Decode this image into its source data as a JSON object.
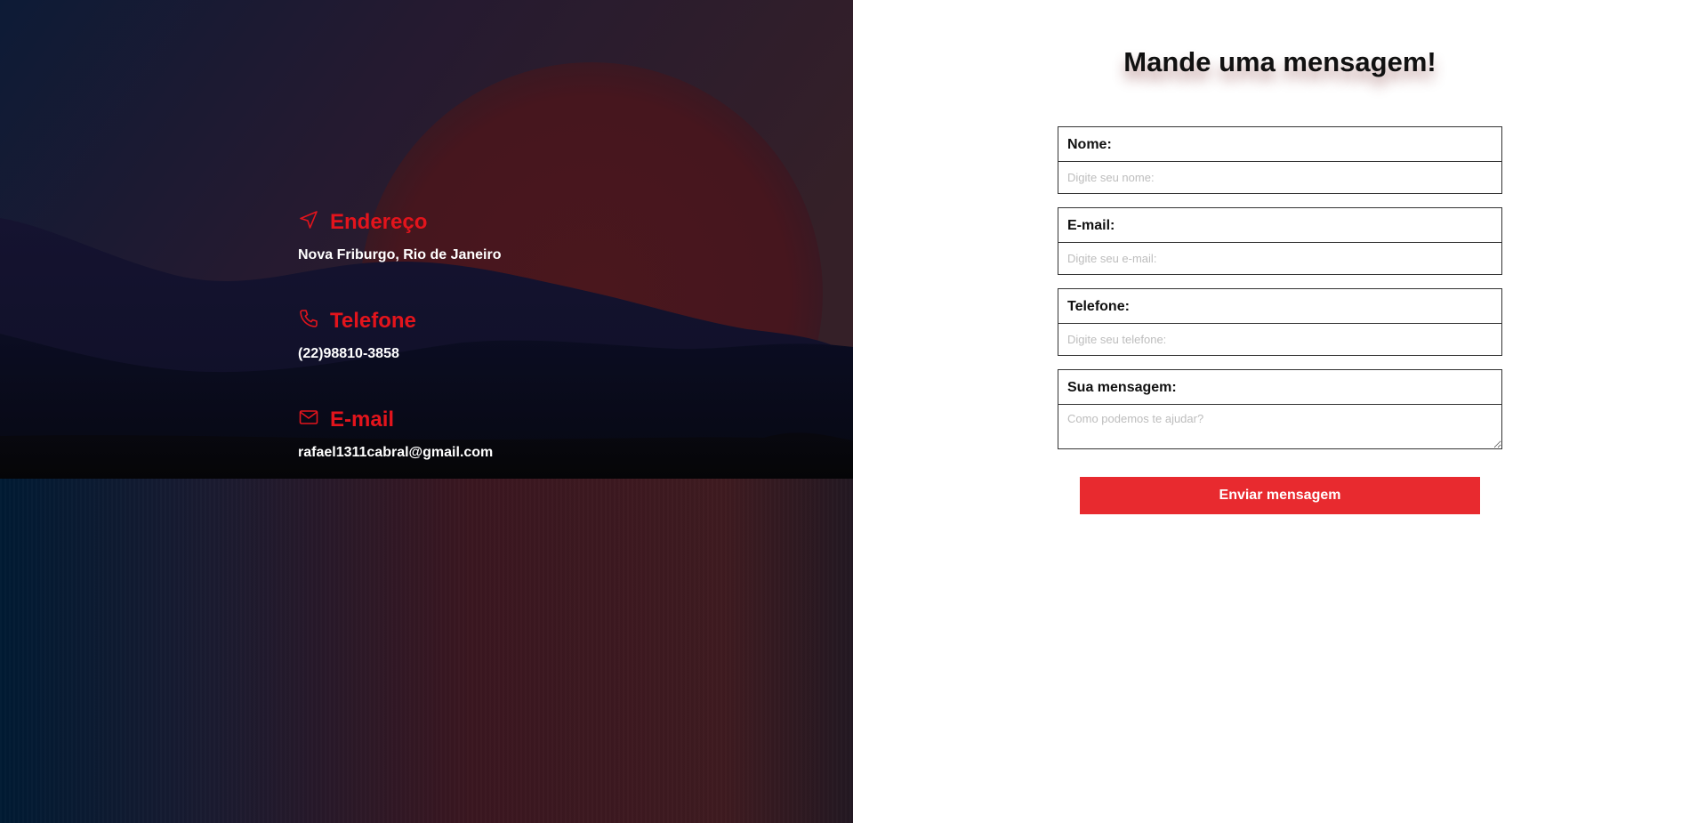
{
  "contact": {
    "address": {
      "title": "Endereço",
      "value": "Nova Friburgo, Rio de Janeiro",
      "icon": "navigation-arrow-icon"
    },
    "phone": {
      "title": "Telefone",
      "value": "(22)98810-3858",
      "icon": "phone-icon"
    },
    "email": {
      "title": "E-mail",
      "value": "rafael1311cabral@gmail.com",
      "icon": "mail-icon"
    }
  },
  "form": {
    "title": "Mande uma mensagem!",
    "name": {
      "label": "Nome:",
      "placeholder": "Digite seu nome:",
      "value": ""
    },
    "email": {
      "label": "E-mail:",
      "placeholder": "Digite seu e-mail:",
      "value": ""
    },
    "phone": {
      "label": "Telefone:",
      "placeholder": "Digite seu telefone:",
      "value": ""
    },
    "message": {
      "label": "Sua mensagem:",
      "placeholder": "Como podemos te ajudar?",
      "value": ""
    },
    "submit_label": "Enviar mensagem"
  },
  "colors": {
    "accent": "#e3141c",
    "button": "#e82a2f",
    "text_light": "#ffffff"
  }
}
